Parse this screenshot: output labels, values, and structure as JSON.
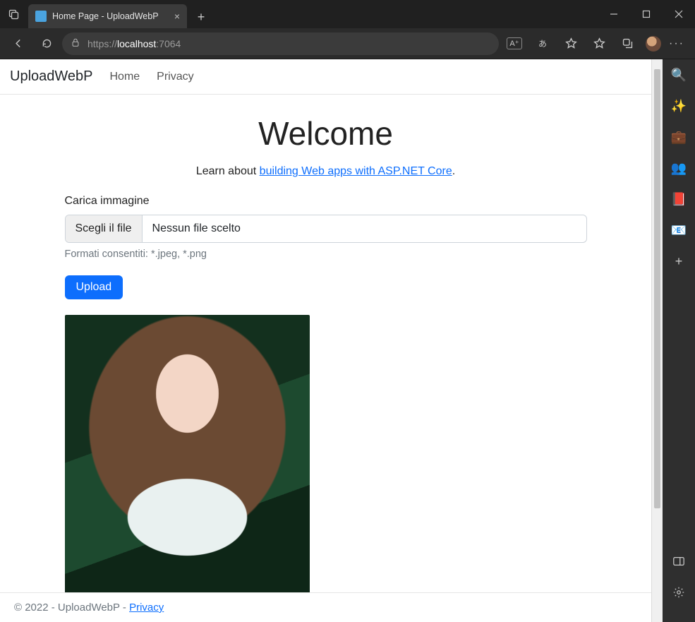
{
  "browser": {
    "tab_title": "Home Page - UploadWebP",
    "url_scheme": "https://",
    "url_host": "localhost",
    "url_port": ":7064"
  },
  "sidebar_icons": {
    "search": "🔍",
    "copilot": "✨",
    "briefcase": "💼",
    "people": "👥",
    "office": "📕",
    "outlook": "📧",
    "add": "+"
  },
  "nav": {
    "brand": "UploadWebP",
    "home": "Home",
    "privacy": "Privacy"
  },
  "hero": {
    "title": "Welcome",
    "learn_prefix": "Learn about ",
    "learn_link": "building Web apps with ASP.NET Core",
    "learn_suffix": "."
  },
  "form": {
    "label": "Carica immagine",
    "choose_file": "Scegli il file",
    "no_file": "Nessun file scelto",
    "help": "Formati consentiti: *.jpeg, *.png",
    "upload_btn": "Upload"
  },
  "footer": {
    "copyright": "© 2022 - UploadWebP - ",
    "privacy_link": "Privacy"
  }
}
